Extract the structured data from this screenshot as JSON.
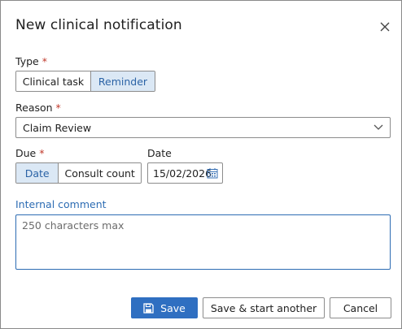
{
  "dialog": {
    "title": "New clinical notification",
    "close_icon": "close-icon"
  },
  "type_field": {
    "label": "Type",
    "required_mark": "*",
    "options": [
      "Clinical task",
      "Reminder"
    ],
    "selected": "Reminder"
  },
  "reason_field": {
    "label": "Reason",
    "required_mark": "*",
    "value": "Claim Review",
    "dropdown_icon": "chevron-down-icon"
  },
  "due_field": {
    "label": "Due",
    "required_mark": "*",
    "options": [
      "Date",
      "Consult count"
    ],
    "selected": "Date"
  },
  "date_field": {
    "label": "Date",
    "value": "15/02/2026",
    "calendar_icon": "calendar-icon"
  },
  "comment_field": {
    "label": "Internal comment",
    "placeholder": "250 characters max"
  },
  "footer": {
    "save_label": "Save",
    "save_icon": "floppy-disk-icon",
    "save_another_label": "Save & start another",
    "cancel_label": "Cancel"
  },
  "colors": {
    "accent": "#2f6fc1",
    "selected_segment_bg": "#dbe8f5",
    "selected_segment_text": "#2b63a6",
    "required": "#c0392b"
  }
}
